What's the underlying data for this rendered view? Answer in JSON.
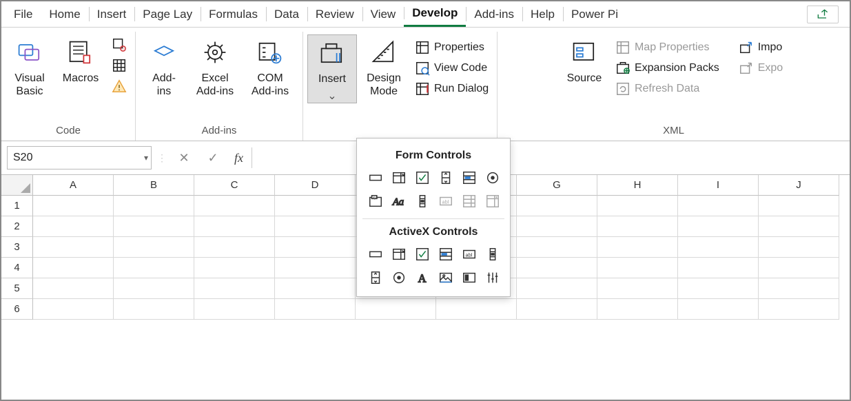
{
  "tabs": {
    "items": [
      "File",
      "Home",
      "Insert",
      "Page Lay",
      "Formulas",
      "Data",
      "Review",
      "View",
      "Develop",
      "Add-ins",
      "Help",
      "Power Pi"
    ],
    "active_index": 8
  },
  "ribbon": {
    "groups": {
      "code": {
        "label": "Code",
        "visual_basic": "Visual\nBasic",
        "macros": "Macros"
      },
      "addins": {
        "label": "Add-ins",
        "addins": "Add-\nins",
        "excel_addins": "Excel\nAdd-ins",
        "com_addins": "COM\nAdd-ins"
      },
      "controls": {
        "insert": "Insert",
        "design_mode": "Design\nMode",
        "properties": "Properties",
        "view_code": "View Code",
        "run_dialog": "Run Dialog"
      },
      "xml": {
        "label": "XML",
        "source": "Source",
        "map_properties": "Map Properties",
        "expansion_packs": "Expansion Packs",
        "refresh_data": "Refresh Data",
        "import": "Impo",
        "export": "Expo"
      }
    }
  },
  "formula_bar": {
    "name_box": "S20",
    "fx": "fx"
  },
  "sheet": {
    "columns": [
      "A",
      "B",
      "C",
      "D",
      "",
      "",
      "G",
      "H",
      "I",
      "J"
    ],
    "rows": [
      "1",
      "2",
      "3",
      "4",
      "5",
      "6"
    ]
  },
  "dropdown": {
    "section1": "Form Controls",
    "section2": "ActiveX Controls",
    "form_controls": [
      {
        "name": "button",
        "disabled": false
      },
      {
        "name": "combo-box",
        "disabled": false
      },
      {
        "name": "check-box",
        "disabled": false
      },
      {
        "name": "spin-button",
        "disabled": false
      },
      {
        "name": "list-box",
        "disabled": false
      },
      {
        "name": "option-button",
        "disabled": false
      },
      {
        "name": "group-box",
        "disabled": false
      },
      {
        "name": "label",
        "disabled": false
      },
      {
        "name": "scroll-bar",
        "disabled": false
      },
      {
        "name": "text-field",
        "disabled": true
      },
      {
        "name": "combo-list",
        "disabled": true
      },
      {
        "name": "combo-dropdown",
        "disabled": true
      }
    ],
    "activex_controls": [
      {
        "name": "command-button",
        "disabled": false
      },
      {
        "name": "combo-box",
        "disabled": false
      },
      {
        "name": "check-box",
        "disabled": false
      },
      {
        "name": "list-box",
        "disabled": false
      },
      {
        "name": "text-box",
        "disabled": false
      },
      {
        "name": "scroll-bar",
        "disabled": false
      },
      {
        "name": "spin-button",
        "disabled": false
      },
      {
        "name": "option-button",
        "disabled": false
      },
      {
        "name": "label",
        "disabled": false
      },
      {
        "name": "image",
        "disabled": false
      },
      {
        "name": "toggle-button",
        "disabled": false
      },
      {
        "name": "more-controls",
        "disabled": false
      }
    ]
  }
}
